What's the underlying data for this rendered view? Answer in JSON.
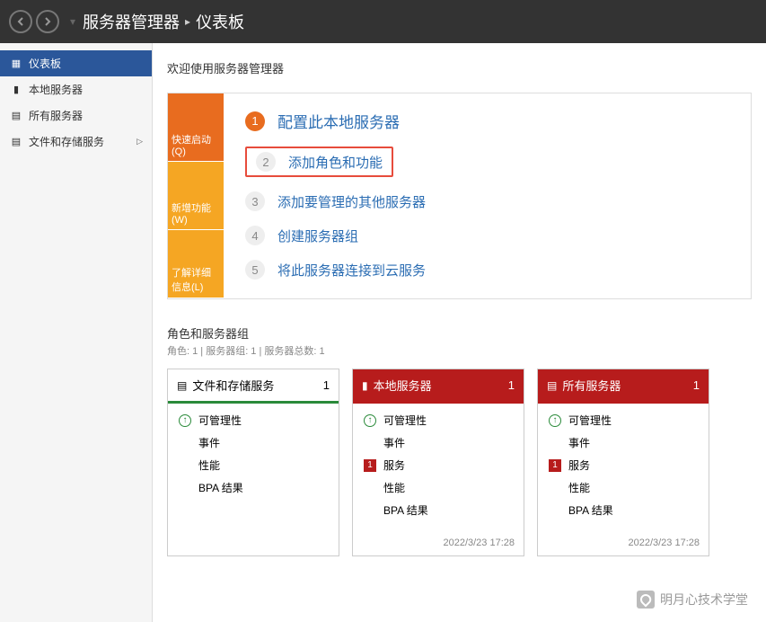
{
  "header": {
    "app_name": "服务器管理器",
    "page": "仪表板"
  },
  "sidebar": {
    "items": [
      {
        "icon": "▦",
        "label": "仪表板",
        "selected": true
      },
      {
        "icon": "▮",
        "label": "本地服务器",
        "selected": false
      },
      {
        "icon": "▤",
        "label": "所有服务器",
        "selected": false
      },
      {
        "icon": "▤",
        "label": "文件和存储服务",
        "selected": false,
        "expandable": true
      }
    ]
  },
  "main": {
    "welcome": "欢迎使用服务器管理器",
    "quickstart": {
      "tabs": [
        {
          "label": "快速启动(Q)"
        },
        {
          "label": "新增功能(W)"
        },
        {
          "label": "了解详细信息(L)"
        }
      ],
      "steps": [
        {
          "num": "1",
          "label": "配置此本地服务器",
          "primary": true
        },
        {
          "num": "2",
          "label": "添加角色和功能",
          "highlighted": true
        },
        {
          "num": "3",
          "label": "添加要管理的其他服务器"
        },
        {
          "num": "4",
          "label": "创建服务器组"
        },
        {
          "num": "5",
          "label": "将此服务器连接到云服务"
        }
      ]
    },
    "roles_section": {
      "title": "角色和服务器组",
      "subtitle": "角色: 1 | 服务器组: 1 | 服务器总数: 1"
    },
    "tiles": [
      {
        "icon": "▤",
        "title": "文件和存储服务",
        "count": "1",
        "style": "ok",
        "rows": [
          {
            "indicator": "ok",
            "label": "可管理性"
          },
          {
            "indicator": "",
            "label": "事件"
          },
          {
            "indicator": "",
            "label": "性能"
          },
          {
            "indicator": "",
            "label": "BPA 结果"
          }
        ],
        "timestamp": ""
      },
      {
        "icon": "▮",
        "title": "本地服务器",
        "count": "1",
        "style": "danger",
        "rows": [
          {
            "indicator": "ok",
            "label": "可管理性"
          },
          {
            "indicator": "",
            "label": "事件"
          },
          {
            "indicator": "alert",
            "alert_num": "1",
            "label": "服务"
          },
          {
            "indicator": "",
            "label": "性能"
          },
          {
            "indicator": "",
            "label": "BPA 结果"
          }
        ],
        "timestamp": "2022/3/23 17:28"
      },
      {
        "icon": "▤",
        "title": "所有服务器",
        "count": "1",
        "style": "danger",
        "rows": [
          {
            "indicator": "ok",
            "label": "可管理性"
          },
          {
            "indicator": "",
            "label": "事件"
          },
          {
            "indicator": "alert",
            "alert_num": "1",
            "label": "服务"
          },
          {
            "indicator": "",
            "label": "性能"
          },
          {
            "indicator": "",
            "label": "BPA 结果"
          }
        ],
        "timestamp": "2022/3/23 17:28"
      }
    ]
  },
  "watermark": "明月心技术学堂"
}
